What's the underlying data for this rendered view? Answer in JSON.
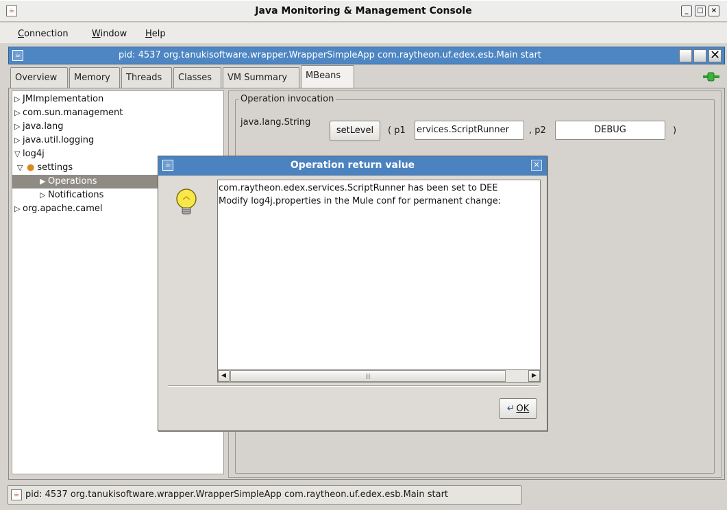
{
  "window": {
    "title": "Java Monitoring & Management Console",
    "controls": [
      "minimize",
      "maximize",
      "close"
    ]
  },
  "menubar": {
    "items": [
      {
        "label": "Connection",
        "mnemonic": "C"
      },
      {
        "label": "Window",
        "mnemonic": "W"
      },
      {
        "label": "Help",
        "mnemonic": "H"
      }
    ]
  },
  "internal_frame": {
    "title": "pid: 4537 org.tanukisoftware.wrapper.WrapperSimpleApp com.raytheon.uf.edex.esb.Main start"
  },
  "tabs": [
    {
      "label": "Overview",
      "active": false
    },
    {
      "label": "Memory",
      "active": false
    },
    {
      "label": "Threads",
      "active": false
    },
    {
      "label": "Classes",
      "active": false
    },
    {
      "label": "VM Summary",
      "active": false
    },
    {
      "label": "MBeans",
      "active": true
    }
  ],
  "tree": {
    "nodes": [
      {
        "label": "JMImplementation",
        "expanded": false
      },
      {
        "label": "com.sun.management",
        "expanded": false
      },
      {
        "label": "java.lang",
        "expanded": false
      },
      {
        "label": "java.util.logging",
        "expanded": false
      },
      {
        "label": "log4j",
        "expanded": true
      },
      {
        "label": "settings",
        "expanded": true
      },
      {
        "label": "Operations",
        "expanded": false,
        "selected": true
      },
      {
        "label": "Notifications",
        "expanded": false
      },
      {
        "label": "org.apache.camel",
        "expanded": false
      }
    ]
  },
  "operation_panel": {
    "legend": "Operation invocation",
    "return_type": "java.lang.String",
    "method_button": "setLevel",
    "open_paren_p1": "( p1",
    "p1_value": "ervices.ScriptRunner",
    "comma_p2": ", p2",
    "p2_value": "DEBUG",
    "close_paren": ")"
  },
  "dialog": {
    "title": "Operation return value",
    "lines": [
      "com.raytheon.edex.services.ScriptRunner has been set to DEE",
      "Modify log4j.properties in the Mule conf for permanent change:"
    ],
    "ok_label": "OK",
    "ok_mnemonic": "O"
  },
  "statusbar": {
    "text": "pid: 4537 org.tanukisoftware.wrapper.WrapperSimpleApp com.raytheon.uf.edex.esb.Main start"
  },
  "colors": {
    "titlebar_blue": "#4d86c3",
    "selection": "#8f8b84",
    "connection_icon": "#2e9e2e"
  }
}
